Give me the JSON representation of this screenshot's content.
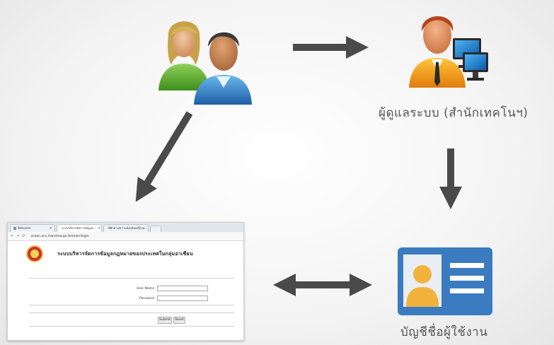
{
  "diagram": {
    "admin_label": "ผู้ดูแลระบบ (สำนักเทคโนฯ)",
    "account_label": "บัญชีชื่อผู้ใช้งาน",
    "icons": {
      "users": "users-icon",
      "admin": "admin-computer-icon",
      "account": "id-card-icon"
    },
    "colors": {
      "arrow": "#4a4a4a",
      "card_blue": "#3b7bbf",
      "caption": "#555555"
    }
  },
  "browser": {
    "tabs": [
      {
        "label": "Welcome"
      },
      {
        "label": "ระบบบริหารจัดการข้อมูลก..."
      },
      {
        "label": "ที่พักคาง/ความน้องสั่นเครื่องน..."
      }
    ],
    "address": "asean.ocs.mwralaw.go.th/main/login",
    "page_title": "ระบบบริหารจัดการข้อมูลกฎหมายของประเทศในกลุ่มอาเซียน",
    "username_label": "User Name",
    "password_label": "Password",
    "submit_label": "Submit",
    "reset_label": "Reset"
  }
}
